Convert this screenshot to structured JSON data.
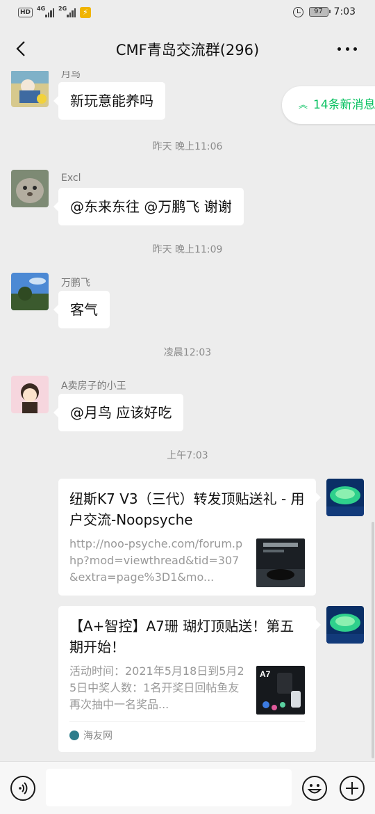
{
  "status_bar": {
    "hd": "HD",
    "network_1": "4G",
    "network_2": "2G",
    "battery": "97",
    "time": "7:03"
  },
  "header": {
    "title": "CMF青岛交流群(296)"
  },
  "new_messages": "14条新消息",
  "messages": [
    {
      "sender": "月鸟",
      "text": "新玩意能养吗"
    },
    {
      "time": "昨天 晚上11:06"
    },
    {
      "sender": "Excl",
      "text": "@东来东往  @万鹏飞  谢谢"
    },
    {
      "time": "昨天 晚上11:09"
    },
    {
      "sender": "万鹏飞",
      "text": "客气"
    },
    {
      "time": "凌晨12:03"
    },
    {
      "sender": "A卖房子的小王",
      "text": "@月鸟  应该好吃"
    },
    {
      "time": "上午7:03"
    }
  ],
  "link_cards": [
    {
      "title": "纽斯K7 V3（三代）转发顶贴送礼 - 用户交流-Noopsyche",
      "description": "http://noo-psyche.com/forum.php?mod=viewthread&tid=307&extra=page%3D1&mo..."
    },
    {
      "title": "【A+智控】A7珊 瑚灯顶贴送！第五期开始！",
      "description": "活动时间：2021年5月18日到5月25日中奖人数：1名开奖日回帖鱼友再次抽中一名奖品...",
      "thumb_label": "A7",
      "source": "海友网"
    }
  ],
  "colors": {
    "accent_green": "#07c160",
    "background": "#ededed",
    "bubble": "#ffffff"
  }
}
